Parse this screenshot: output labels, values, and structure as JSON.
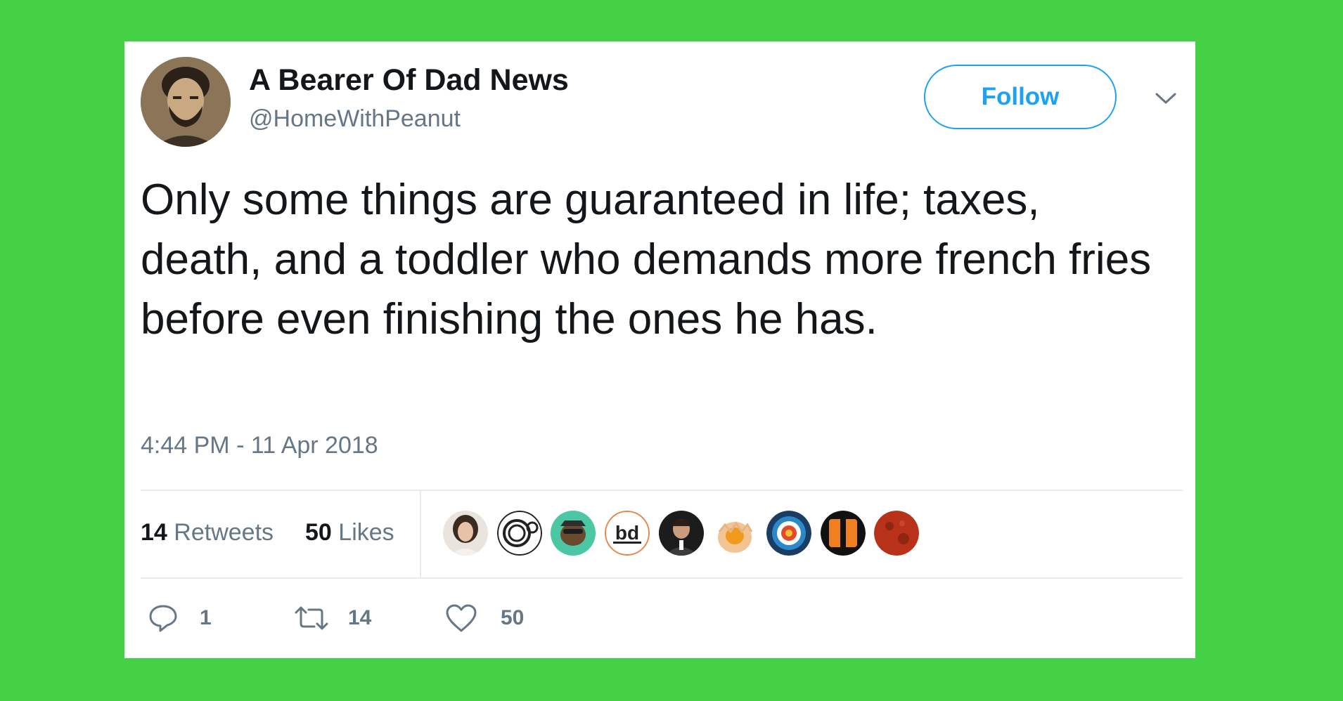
{
  "colors": {
    "background": "#45d145",
    "card": "#ffffff",
    "accent": "#1da1f2",
    "text": "#14171a",
    "muted": "#657786"
  },
  "user": {
    "display_name": "A Bearer Of Dad News",
    "handle": "@HomeWithPeanut",
    "avatar_icon": "user-avatar"
  },
  "header": {
    "follow_label": "Follow",
    "menu_icon": "chevron-down-icon"
  },
  "tweet": {
    "text": "Only some things are guaranteed in life; taxes, death, and a toddler who demands more french fries before even finishing the ones he has.",
    "timestamp": "4:44 PM - 11 Apr 2018"
  },
  "stats": {
    "retweets_count": "14",
    "retweets_label": "Retweets",
    "likes_count": "50",
    "likes_label": "Likes"
  },
  "likers": [
    {
      "icon": "liker-avatar-woman"
    },
    {
      "icon": "liker-avatar-mono-logo"
    },
    {
      "icon": "liker-avatar-green-cartoon"
    },
    {
      "icon": "liker-avatar-bd-logo"
    },
    {
      "icon": "liker-avatar-man-dark"
    },
    {
      "icon": "liker-avatar-egg"
    },
    {
      "icon": "liker-avatar-target"
    },
    {
      "icon": "liker-avatar-orange-slash"
    },
    {
      "icon": "liker-avatar-red-moon"
    }
  ],
  "actions": {
    "reply_count": "1",
    "retweet_count": "14",
    "like_count": "50"
  }
}
